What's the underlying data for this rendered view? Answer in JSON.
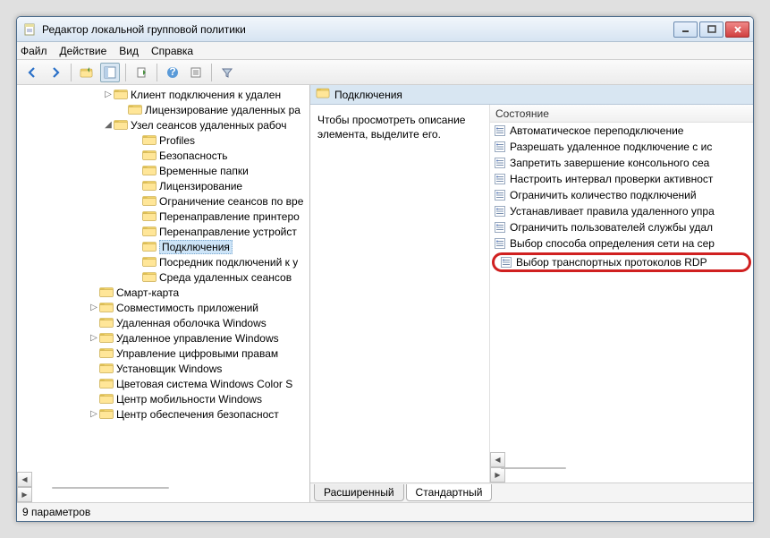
{
  "window": {
    "title": "Редактор локальной групповой политики"
  },
  "menu": {
    "file": "Файл",
    "action": "Действие",
    "view": "Вид",
    "help": "Справка"
  },
  "tree": {
    "items": [
      {
        "indent": 96,
        "expander": "▷",
        "label": "Клиент подключения к удален"
      },
      {
        "indent": 112,
        "expander": "",
        "label": "Лицензирование удаленных ра"
      },
      {
        "indent": 96,
        "expander": "◢",
        "label": "Узел сеансов удаленных рабоч"
      },
      {
        "indent": 128,
        "expander": "",
        "label": "Profiles"
      },
      {
        "indent": 128,
        "expander": "",
        "label": "Безопасность"
      },
      {
        "indent": 128,
        "expander": "",
        "label": "Временные папки"
      },
      {
        "indent": 128,
        "expander": "",
        "label": "Лицензирование"
      },
      {
        "indent": 128,
        "expander": "",
        "label": "Ограничение сеансов по вре"
      },
      {
        "indent": 128,
        "expander": "",
        "label": "Перенаправление принтеро"
      },
      {
        "indent": 128,
        "expander": "",
        "label": "Перенаправление устройст"
      },
      {
        "indent": 128,
        "expander": "",
        "label": "Подключения",
        "selected": true
      },
      {
        "indent": 128,
        "expander": "",
        "label": "Посредник подключений к у"
      },
      {
        "indent": 128,
        "expander": "",
        "label": "Среда удаленных сеансов"
      },
      {
        "indent": 80,
        "expander": "",
        "label": "Смарт-карта"
      },
      {
        "indent": 80,
        "expander": "▷",
        "label": "Совместимость приложений"
      },
      {
        "indent": 80,
        "expander": "",
        "label": "Удаленная оболочка Windows"
      },
      {
        "indent": 80,
        "expander": "▷",
        "label": "Удаленное управление Windows"
      },
      {
        "indent": 80,
        "expander": "",
        "label": "Управление цифровыми правам"
      },
      {
        "indent": 80,
        "expander": "",
        "label": "Установщик Windows"
      },
      {
        "indent": 80,
        "expander": "",
        "label": "Цветовая система Windows Color S"
      },
      {
        "indent": 80,
        "expander": "",
        "label": "Центр мобильности Windows"
      },
      {
        "indent": 80,
        "expander": "▷",
        "label": "Центр обеспечения безопасност"
      }
    ]
  },
  "right": {
    "header_title": "Подключения",
    "description": "Чтобы просмотреть описание элемента, выделите его.",
    "column_header": "Состояние",
    "items": [
      "Автоматическое переподключение",
      "Разрешать удаленное подключение с ис",
      "Запретить завершение консольного сеа",
      "Настроить интервал проверки активност",
      "Ограничить количество подключений",
      "Устанавливает правила удаленного упра",
      "Ограничить пользователей службы удал",
      "Выбор способа определения сети на сер"
    ],
    "highlighted_item": "Выбор транспортных протоколов RDP",
    "tabs": {
      "extended": "Расширенный",
      "standard": "Стандартный"
    }
  },
  "status": {
    "text": "9 параметров"
  }
}
